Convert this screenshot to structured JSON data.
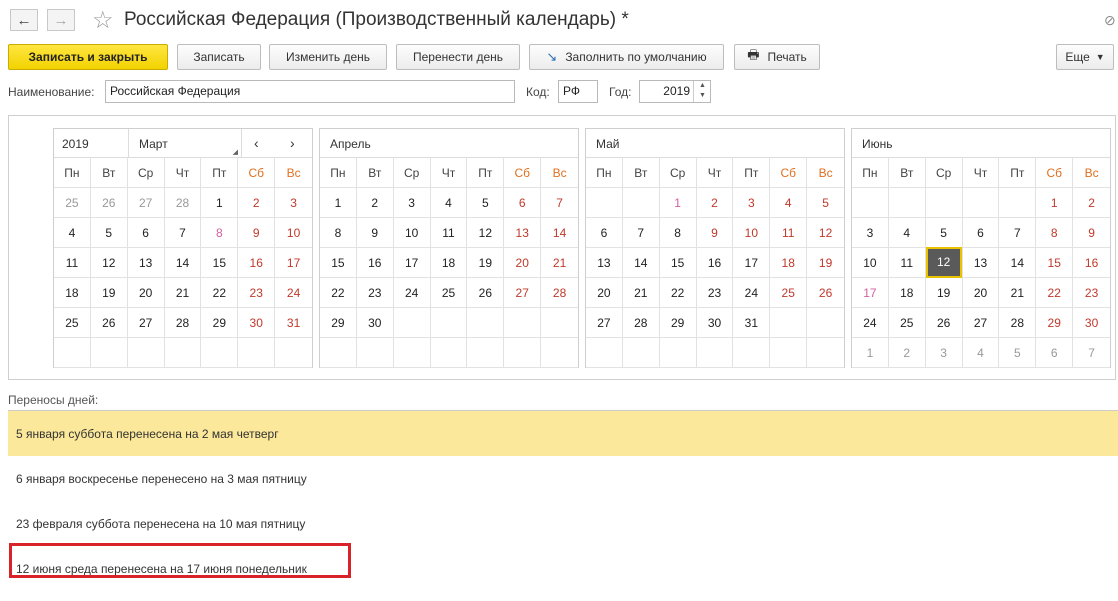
{
  "window": {
    "title": "Российская Федерация (Производственный календарь) *"
  },
  "toolbar": {
    "save_close": "Записать и закрыть",
    "save": "Записать",
    "change_day": "Изменить день",
    "move_day": "Перенести день",
    "fill_default": "Заполнить по умолчанию",
    "print": "Печать",
    "more": "Еще"
  },
  "form": {
    "name_label": "Наименование:",
    "name_value": "Российская Федерация",
    "code_label": "Код:",
    "code_value": "РФ",
    "year_label": "Год:",
    "year_value": "2019"
  },
  "weekdays": [
    "Пн",
    "Вт",
    "Ср",
    "Чт",
    "Пт",
    "Сб",
    "Вс"
  ],
  "months": [
    {
      "name": "Март",
      "year": "2019",
      "cells": [
        {
          "d": "25",
          "t": "other"
        },
        {
          "d": "26",
          "t": "other"
        },
        {
          "d": "27",
          "t": "other"
        },
        {
          "d": "28",
          "t": "other"
        },
        {
          "d": "1",
          "t": ""
        },
        {
          "d": "2",
          "t": "we"
        },
        {
          "d": "3",
          "t": "we"
        },
        {
          "d": "4",
          "t": ""
        },
        {
          "d": "5",
          "t": ""
        },
        {
          "d": "6",
          "t": ""
        },
        {
          "d": "7",
          "t": ""
        },
        {
          "d": "8",
          "t": "pre"
        },
        {
          "d": "9",
          "t": "we"
        },
        {
          "d": "10",
          "t": "we"
        },
        {
          "d": "11",
          "t": ""
        },
        {
          "d": "12",
          "t": ""
        },
        {
          "d": "13",
          "t": ""
        },
        {
          "d": "14",
          "t": ""
        },
        {
          "d": "15",
          "t": ""
        },
        {
          "d": "16",
          "t": "we"
        },
        {
          "d": "17",
          "t": "we"
        },
        {
          "d": "18",
          "t": ""
        },
        {
          "d": "19",
          "t": ""
        },
        {
          "d": "20",
          "t": ""
        },
        {
          "d": "21",
          "t": ""
        },
        {
          "d": "22",
          "t": ""
        },
        {
          "d": "23",
          "t": "we"
        },
        {
          "d": "24",
          "t": "we"
        },
        {
          "d": "25",
          "t": ""
        },
        {
          "d": "26",
          "t": ""
        },
        {
          "d": "27",
          "t": ""
        },
        {
          "d": "28",
          "t": ""
        },
        {
          "d": "29",
          "t": ""
        },
        {
          "d": "30",
          "t": "we"
        },
        {
          "d": "31",
          "t": "we"
        },
        {
          "d": "",
          "t": ""
        },
        {
          "d": "",
          "t": ""
        },
        {
          "d": "",
          "t": ""
        },
        {
          "d": "",
          "t": ""
        },
        {
          "d": "",
          "t": ""
        },
        {
          "d": "",
          "t": ""
        },
        {
          "d": "",
          "t": ""
        }
      ]
    },
    {
      "name": "Апрель",
      "cells": [
        {
          "d": "1",
          "t": ""
        },
        {
          "d": "2",
          "t": ""
        },
        {
          "d": "3",
          "t": ""
        },
        {
          "d": "4",
          "t": ""
        },
        {
          "d": "5",
          "t": ""
        },
        {
          "d": "6",
          "t": "we"
        },
        {
          "d": "7",
          "t": "we"
        },
        {
          "d": "8",
          "t": ""
        },
        {
          "d": "9",
          "t": ""
        },
        {
          "d": "10",
          "t": ""
        },
        {
          "d": "11",
          "t": ""
        },
        {
          "d": "12",
          "t": ""
        },
        {
          "d": "13",
          "t": "we"
        },
        {
          "d": "14",
          "t": "we"
        },
        {
          "d": "15",
          "t": ""
        },
        {
          "d": "16",
          "t": ""
        },
        {
          "d": "17",
          "t": ""
        },
        {
          "d": "18",
          "t": ""
        },
        {
          "d": "19",
          "t": ""
        },
        {
          "d": "20",
          "t": "we"
        },
        {
          "d": "21",
          "t": "we"
        },
        {
          "d": "22",
          "t": ""
        },
        {
          "d": "23",
          "t": ""
        },
        {
          "d": "24",
          "t": ""
        },
        {
          "d": "25",
          "t": ""
        },
        {
          "d": "26",
          "t": ""
        },
        {
          "d": "27",
          "t": "we"
        },
        {
          "d": "28",
          "t": "we"
        },
        {
          "d": "29",
          "t": ""
        },
        {
          "d": "30",
          "t": ""
        },
        {
          "d": "",
          "t": ""
        },
        {
          "d": "",
          "t": ""
        },
        {
          "d": "",
          "t": ""
        },
        {
          "d": "",
          "t": ""
        },
        {
          "d": "",
          "t": ""
        },
        {
          "d": "",
          "t": ""
        },
        {
          "d": "",
          "t": ""
        },
        {
          "d": "",
          "t": ""
        },
        {
          "d": "",
          "t": ""
        },
        {
          "d": "",
          "t": ""
        },
        {
          "d": "",
          "t": ""
        },
        {
          "d": "",
          "t": ""
        }
      ]
    },
    {
      "name": "Май",
      "cells": [
        {
          "d": "",
          "t": ""
        },
        {
          "d": "",
          "t": ""
        },
        {
          "d": "1",
          "t": "pre"
        },
        {
          "d": "2",
          "t": "we"
        },
        {
          "d": "3",
          "t": "we"
        },
        {
          "d": "4",
          "t": "we"
        },
        {
          "d": "5",
          "t": "we"
        },
        {
          "d": "6",
          "t": ""
        },
        {
          "d": "7",
          "t": ""
        },
        {
          "d": "8",
          "t": ""
        },
        {
          "d": "9",
          "t": "we"
        },
        {
          "d": "10",
          "t": "we"
        },
        {
          "d": "11",
          "t": "we"
        },
        {
          "d": "12",
          "t": "we"
        },
        {
          "d": "13",
          "t": ""
        },
        {
          "d": "14",
          "t": ""
        },
        {
          "d": "15",
          "t": ""
        },
        {
          "d": "16",
          "t": ""
        },
        {
          "d": "17",
          "t": ""
        },
        {
          "d": "18",
          "t": "we"
        },
        {
          "d": "19",
          "t": "we"
        },
        {
          "d": "20",
          "t": ""
        },
        {
          "d": "21",
          "t": ""
        },
        {
          "d": "22",
          "t": ""
        },
        {
          "d": "23",
          "t": ""
        },
        {
          "d": "24",
          "t": ""
        },
        {
          "d": "25",
          "t": "we"
        },
        {
          "d": "26",
          "t": "we"
        },
        {
          "d": "27",
          "t": ""
        },
        {
          "d": "28",
          "t": ""
        },
        {
          "d": "29",
          "t": ""
        },
        {
          "d": "30",
          "t": ""
        },
        {
          "d": "31",
          "t": ""
        },
        {
          "d": "",
          "t": ""
        },
        {
          "d": "",
          "t": ""
        },
        {
          "d": "",
          "t": ""
        },
        {
          "d": "",
          "t": ""
        },
        {
          "d": "",
          "t": ""
        },
        {
          "d": "",
          "t": ""
        },
        {
          "d": "",
          "t": ""
        },
        {
          "d": "",
          "t": ""
        },
        {
          "d": "",
          "t": ""
        }
      ]
    },
    {
      "name": "Июнь",
      "cells": [
        {
          "d": "",
          "t": ""
        },
        {
          "d": "",
          "t": ""
        },
        {
          "d": "",
          "t": ""
        },
        {
          "d": "",
          "t": ""
        },
        {
          "d": "",
          "t": ""
        },
        {
          "d": "1",
          "t": "we"
        },
        {
          "d": "2",
          "t": "we"
        },
        {
          "d": "3",
          "t": ""
        },
        {
          "d": "4",
          "t": ""
        },
        {
          "d": "5",
          "t": ""
        },
        {
          "d": "6",
          "t": ""
        },
        {
          "d": "7",
          "t": ""
        },
        {
          "d": "8",
          "t": "we"
        },
        {
          "d": "9",
          "t": "we"
        },
        {
          "d": "10",
          "t": ""
        },
        {
          "d": "11",
          "t": ""
        },
        {
          "d": "12",
          "t": "sel"
        },
        {
          "d": "13",
          "t": ""
        },
        {
          "d": "14",
          "t": ""
        },
        {
          "d": "15",
          "t": "we"
        },
        {
          "d": "16",
          "t": "we"
        },
        {
          "d": "17",
          "t": "pre"
        },
        {
          "d": "18",
          "t": ""
        },
        {
          "d": "19",
          "t": ""
        },
        {
          "d": "20",
          "t": ""
        },
        {
          "d": "21",
          "t": ""
        },
        {
          "d": "22",
          "t": "we"
        },
        {
          "d": "23",
          "t": "we"
        },
        {
          "d": "24",
          "t": ""
        },
        {
          "d": "25",
          "t": ""
        },
        {
          "d": "26",
          "t": ""
        },
        {
          "d": "27",
          "t": ""
        },
        {
          "d": "28",
          "t": ""
        },
        {
          "d": "29",
          "t": "we"
        },
        {
          "d": "30",
          "t": "we"
        },
        {
          "d": "1",
          "t": "other"
        },
        {
          "d": "2",
          "t": "other"
        },
        {
          "d": "3",
          "t": "other"
        },
        {
          "d": "4",
          "t": "other"
        },
        {
          "d": "5",
          "t": "other"
        },
        {
          "d": "6",
          "t": "other"
        },
        {
          "d": "7",
          "t": "other"
        }
      ]
    }
  ],
  "transfers": {
    "label": "Переносы дней:",
    "items": [
      "5 января суббота перенесена на 2 мая четверг",
      "6 января воскресенье перенесено на 3 мая пятницу",
      "23 февраля суббота перенесена на 10 мая пятницу",
      "12 июня среда перенесена на 17 июня понедельник"
    ]
  },
  "colors": {
    "accent": "#f2d200",
    "weekend": "#c0392b",
    "highlight_row": "#fbe89a",
    "annotation": "#d9232a"
  }
}
